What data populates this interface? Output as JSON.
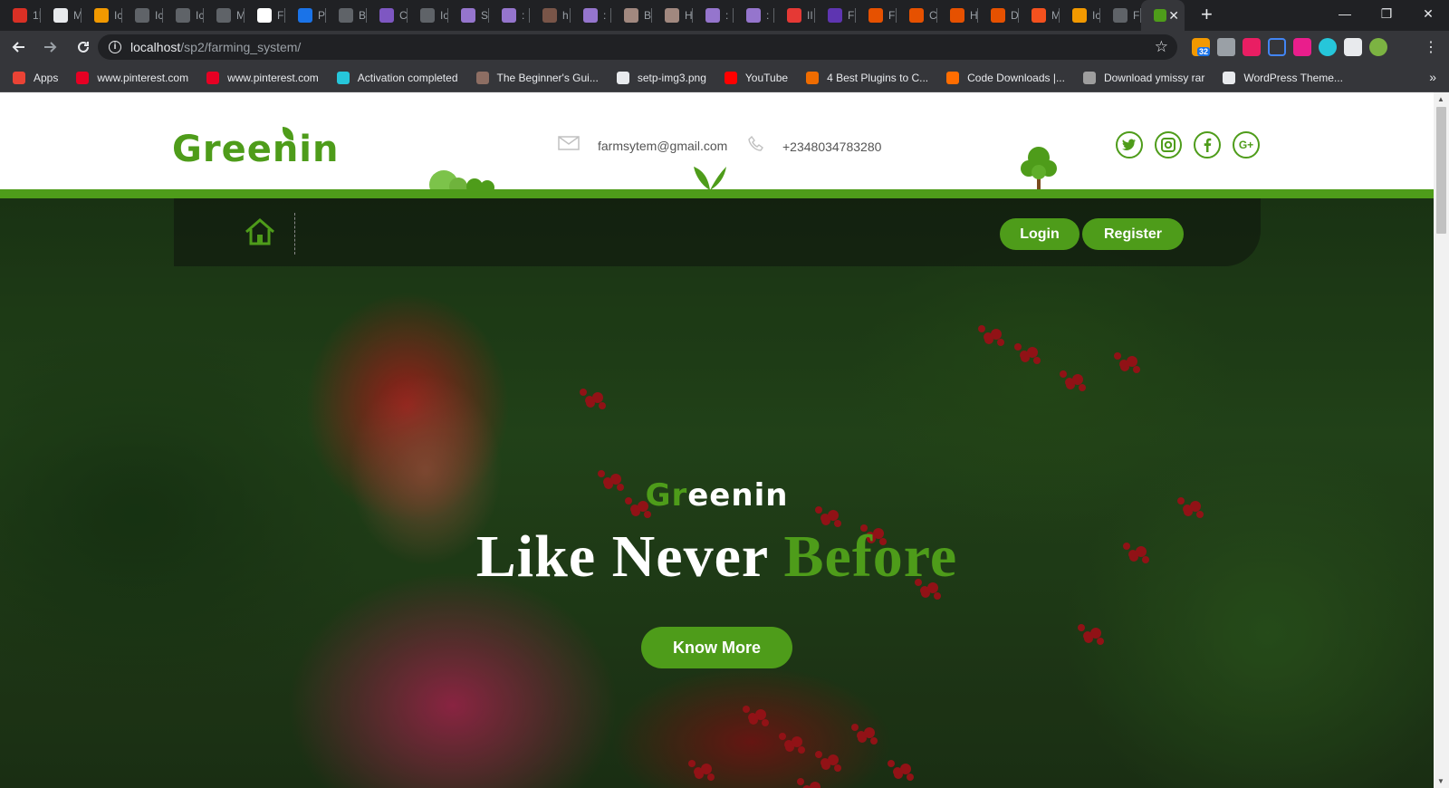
{
  "browser": {
    "tabs": [
      {
        "title": "1!",
        "color": "#d93025"
      },
      {
        "title": "M",
        "color": "#e8eaed"
      },
      {
        "title": "Ic",
        "color": "#f29900"
      },
      {
        "title": "Ic",
        "color": "#5f6368"
      },
      {
        "title": "Ic",
        "color": "#5f6368"
      },
      {
        "title": "M",
        "color": "#5f6368"
      },
      {
        "title": "F",
        "color": "#ffffff"
      },
      {
        "title": "P",
        "color": "#1a73e8"
      },
      {
        "title": "B",
        "color": "#5f6368"
      },
      {
        "title": "C",
        "color": "#7e57c2"
      },
      {
        "title": "Ic",
        "color": "#5f6368"
      },
      {
        "title": "S",
        "color": "#9575cd"
      },
      {
        "title": ":",
        "color": "#9575cd"
      },
      {
        "title": "h",
        "color": "#795548"
      },
      {
        "title": ":",
        "color": "#9575cd"
      },
      {
        "title": "B",
        "color": "#a1887f"
      },
      {
        "title": "H",
        "color": "#a1887f"
      },
      {
        "title": ":",
        "color": "#9575cd"
      },
      {
        "title": ":",
        "color": "#9575cd"
      },
      {
        "title": "II",
        "color": "#e53935"
      },
      {
        "title": "F",
        "color": "#5e35b1"
      },
      {
        "title": "F",
        "color": "#e65100"
      },
      {
        "title": "C",
        "color": "#e65100"
      },
      {
        "title": "H",
        "color": "#e65100"
      },
      {
        "title": "D",
        "color": "#e65100"
      },
      {
        "title": "M",
        "color": "#f4511e"
      },
      {
        "title": "Ic",
        "color": "#f29900"
      },
      {
        "title": "F",
        "color": "#5f6368"
      }
    ],
    "active_tab": {
      "title": "",
      "close": "✕",
      "color": "#4e9c1a"
    },
    "new_tab": "+",
    "window_controls": {
      "minimize": "—",
      "restore": "❐",
      "close": "✕"
    },
    "url_host": "localhost",
    "url_path": "/sp2/farming_system/",
    "extension_badge": "32",
    "bookmarks": [
      {
        "label": "Apps",
        "color": "#ea4335"
      },
      {
        "label": "www.pinterest.com",
        "color": "#e60023"
      },
      {
        "label": "www.pinterest.com",
        "color": "#e60023"
      },
      {
        "label": "Activation completed",
        "color": "#26c6da"
      },
      {
        "label": "The Beginner's Gui...",
        "color": "#8d6e63"
      },
      {
        "label": "setp-img3.png",
        "color": "#e8eaed"
      },
      {
        "label": "YouTube",
        "color": "#ff0000"
      },
      {
        "label": "4 Best Plugins to C...",
        "color": "#ef6c00"
      },
      {
        "label": "Code Downloads |...",
        "color": "#ff6d00"
      },
      {
        "label": "Download ymissy rar",
        "color": "#9e9e9e"
      },
      {
        "label": "WordPress Theme...",
        "color": "#e8eaed"
      }
    ],
    "bookmarks_more": "»"
  },
  "site": {
    "logo_green": "Gr",
    "logo_rest": "eenin",
    "email": "farmsytem@gmail.com",
    "phone": "+2348034783280",
    "social": [
      {
        "name": "twitter",
        "glyph": "t"
      },
      {
        "name": "instagram",
        "glyph": "◙"
      },
      {
        "name": "facebook",
        "glyph": "f"
      },
      {
        "name": "google-plus",
        "glyph": "G+"
      }
    ],
    "accent_color": "#4e9c1a",
    "nav": {
      "login_label": "Login",
      "register_label": "Register"
    },
    "hero": {
      "logo_green": "Gr",
      "logo_white": "eenin",
      "title_white": "Like Never",
      "title_green": "Before",
      "cta_label": "Know More"
    }
  }
}
